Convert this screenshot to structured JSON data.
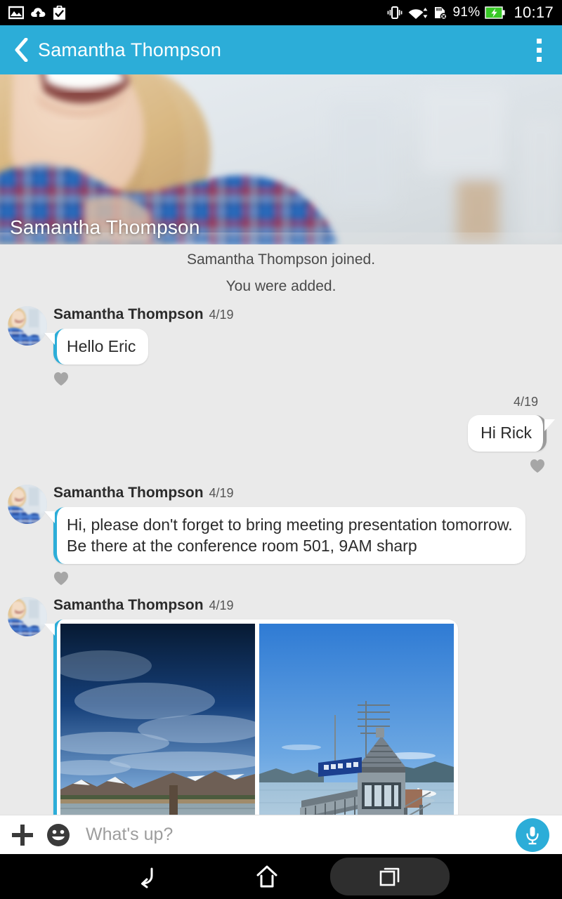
{
  "status_bar": {
    "left_icons": [
      "image-icon",
      "cloud-upload-icon",
      "clipboard-check-icon"
    ],
    "right_icons": [
      "vibrate-icon",
      "wifi-icon",
      "sd-card-removed-icon",
      "battery-charging-icon"
    ],
    "battery_percent": "91%",
    "clock": "10:17"
  },
  "app_bar": {
    "back_icon": "back-chevron-icon",
    "title": "Samantha Thompson",
    "overflow_icon": "overflow-menu-icon",
    "background_color": "#2cadd8"
  },
  "cover": {
    "name": "Samantha Thompson",
    "description": "blonde-woman-smiling-plaid-shirt"
  },
  "thread": {
    "system_messages": [
      "Samantha Thompson joined.",
      "You were added."
    ],
    "messages": [
      {
        "id": "msg-1",
        "direction": "incoming",
        "sender": "Samantha Thompson",
        "date": "4/19",
        "type": "text",
        "text": "Hello Eric",
        "like_icon": "heart-icon"
      },
      {
        "id": "msg-2",
        "direction": "outgoing",
        "date": "4/19",
        "type": "text",
        "text": "Hi Rick",
        "like_icon": "heart-icon"
      },
      {
        "id": "msg-3",
        "direction": "incoming",
        "sender": "Samantha Thompson",
        "date": "4/19",
        "type": "text",
        "text": "Hi, please don't forget to bring meeting presentation tomorrow. Be there at the conference room 501, 9AM sharp",
        "like_icon": "heart-icon"
      },
      {
        "id": "msg-4",
        "direction": "incoming",
        "sender": "Samantha Thompson",
        "date": "4/19",
        "type": "photos",
        "photos": [
          {
            "alt": "lake-with-snowy-mountains-and-clouds"
          },
          {
            "alt": "lakeside-boathouse-with-seaplane"
          }
        ]
      }
    ]
  },
  "input_bar": {
    "add_icon": "plus-icon",
    "emoji_icon": "smiley-icon",
    "placeholder": "What's up?",
    "value": "",
    "mic_icon": "microphone-icon",
    "mic_color": "#2cadd8"
  },
  "nav_bar": {
    "back_icon": "nav-back-icon",
    "home_icon": "nav-home-icon",
    "recents_icon": "nav-recents-icon"
  }
}
